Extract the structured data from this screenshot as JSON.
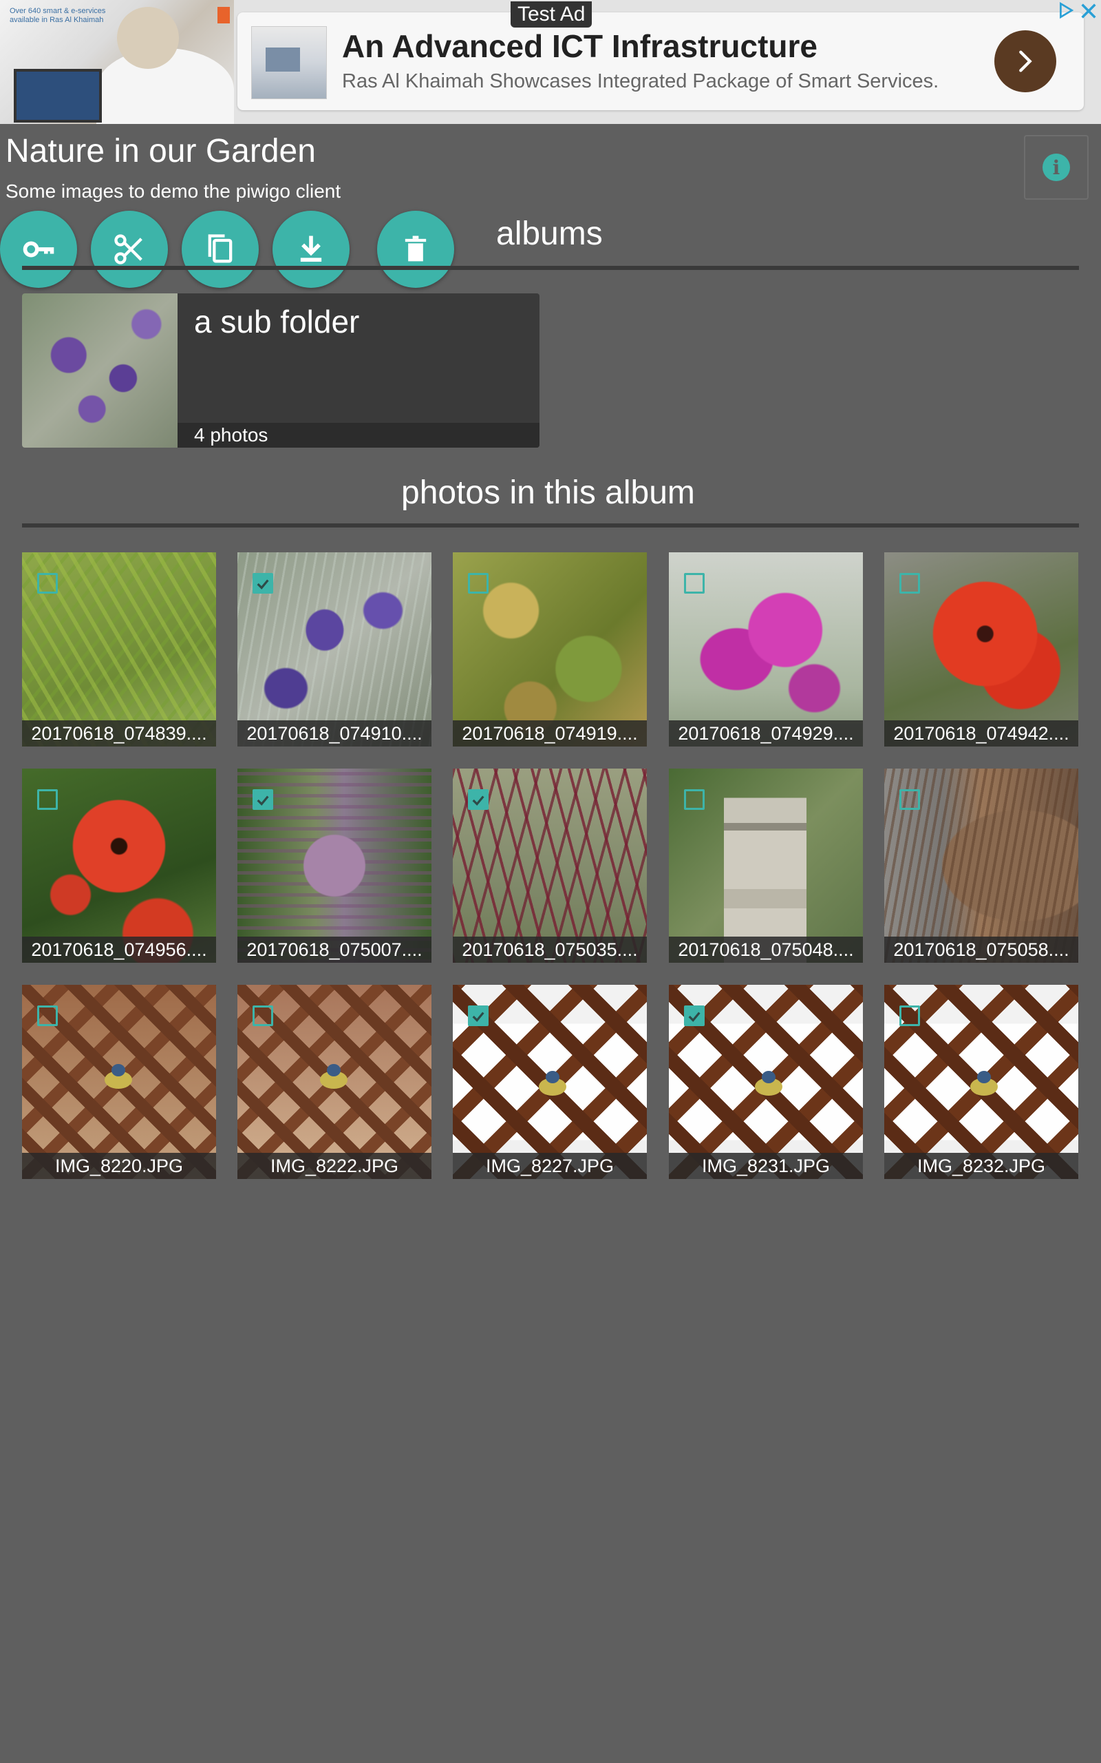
{
  "ad": {
    "label": "Test Ad",
    "headline": "An Advanced ICT Infrastructure",
    "description": "Ras Al Khaimah Showcases Integrated Package of Smart Services.",
    "tiny_text": "Over 640 smart & e-services available in Ras Al Khaimah"
  },
  "album": {
    "title": "Nature in our Garden",
    "subtitle": "Some images to demo the piwigo client"
  },
  "toolbar": {
    "buttons": [
      "key-icon",
      "scissors-icon",
      "copy-icon",
      "download-icon",
      "trash-icon"
    ]
  },
  "sections": {
    "albums": "albums",
    "photos": "photos in this album"
  },
  "subalbums": [
    {
      "name": "a sub folder",
      "count": "4 photos"
    }
  ],
  "photos": [
    {
      "caption": "20170618_074839....",
      "checked": false
    },
    {
      "caption": "20170618_074910....",
      "checked": true
    },
    {
      "caption": "20170618_074919....",
      "checked": false
    },
    {
      "caption": "20170618_074929....",
      "checked": false
    },
    {
      "caption": "20170618_074942....",
      "checked": false
    },
    {
      "caption": "20170618_074956....",
      "checked": false
    },
    {
      "caption": "20170618_075007....",
      "checked": true
    },
    {
      "caption": "20170618_075035....",
      "checked": true
    },
    {
      "caption": "20170618_075048....",
      "checked": false
    },
    {
      "caption": "20170618_075058....",
      "checked": false
    },
    {
      "caption": "IMG_8220.JPG",
      "checked": false
    },
    {
      "caption": "IMG_8222.JPG",
      "checked": false
    },
    {
      "caption": "IMG_8227.JPG",
      "checked": true
    },
    {
      "caption": "IMG_8231.JPG",
      "checked": true
    },
    {
      "caption": "IMG_8232.JPG",
      "checked": false
    }
  ],
  "colors": {
    "accent": "#3db4a9",
    "background": "#5f5f5f",
    "ad_button": "#5a3a22"
  }
}
